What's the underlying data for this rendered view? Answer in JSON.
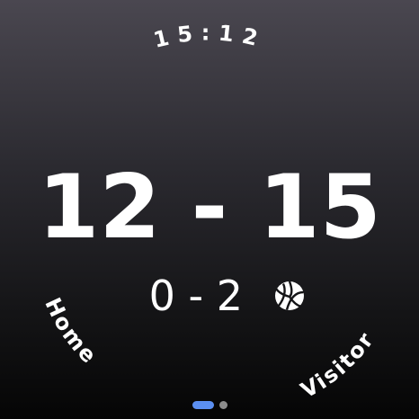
{
  "clock": {
    "time": "15:12"
  },
  "score": {
    "home_points": "12",
    "separator": "-",
    "visitor_points": "15",
    "home_sets": "0",
    "sets_separator": "-",
    "visitor_sets": "2"
  },
  "teams": {
    "home_label": "Home",
    "visitor_label": "Visitor"
  },
  "icons": {
    "serve_indicator": "volleyball-icon"
  },
  "pager": {
    "total_pages": 2,
    "active_page": 1
  },
  "colors": {
    "accent": "#5b8ff2",
    "text": "#ffffff",
    "inactive_dot": "#8d8d8d"
  }
}
